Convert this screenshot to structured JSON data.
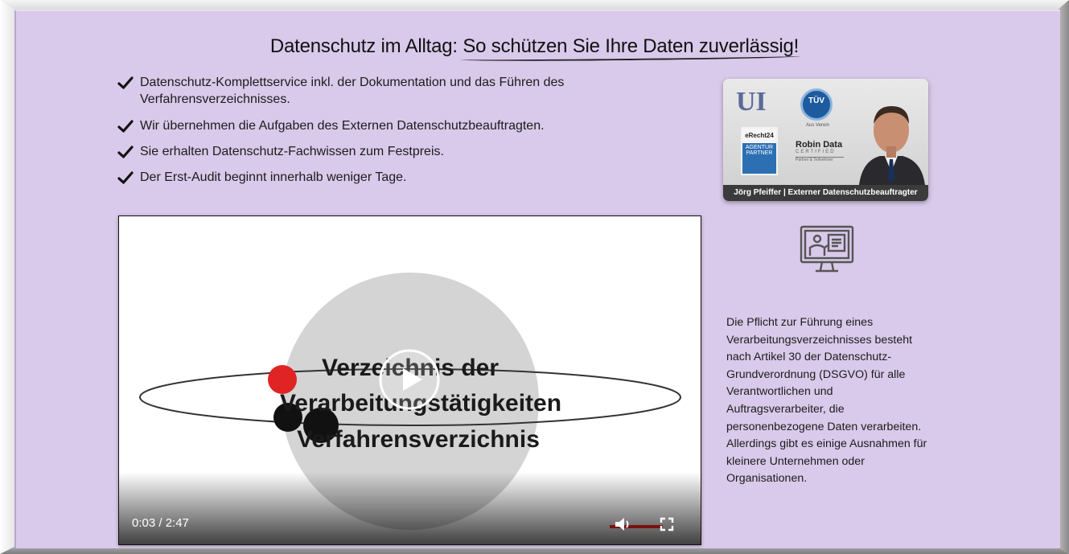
{
  "heading": {
    "plain": "Datenschutz im Alltag: ",
    "highlight": "So schützen Sie Ihre Daten zuverlässig!"
  },
  "bullets": [
    "Datenschutz-Komplettservice inkl. der Dokumentation und das Führen des Verfahrensverzeichnisses.",
    "Wir übernehmen die Aufgaben des Externen Datenschutzbeauftragten.",
    "Sie erhalten Datenschutz-Fachwissen zum Festpreis.",
    "Der Erst-Audit beginnt innerhalb weniger Tage."
  ],
  "badge_card": {
    "ui_logo": "UI",
    "tuv": "TÜV",
    "tuv_sub": "Aus Verein",
    "erecht_top": "eRecht24",
    "erecht_body": "AGENTUR PARTNER",
    "robin_name": "Robin Data",
    "robin_cert": "CERTIFIED",
    "robin_sub": "Partner & Teilnehmer",
    "caption": "Jörg Pfeiffer | Externer Datenschutzbeauftragter"
  },
  "side_text": "Die Pflicht zur Führung eines Verarbeitungsverzeichnisses besteht nach Artikel 30 der Datenschutz-Grundverordnung (DSGVO) für alle Verantwortlichen und Auftragsverarbeiter, die personenbezogene Daten verarbeiten. Allerdings gibt es einige Ausnahmen für kleinere Unternehmen oder Organisationen.",
  "video": {
    "line1": "Verzeichnis der",
    "line2": "Verarbeitungstätigkeiten",
    "line3": "Verfahrensverzichnis",
    "time": "0:03 / 2:47",
    "volume_fraction": 1.0
  },
  "colors": {
    "panel_bg": "#d9c9ea",
    "caption_bg": "#3b3b3b",
    "volume_bar": "#7a1010",
    "accent_red": "#e02424"
  },
  "icons": [
    "check-icon",
    "presentation-icon",
    "play-icon",
    "volume-icon",
    "fullscreen-icon"
  ]
}
